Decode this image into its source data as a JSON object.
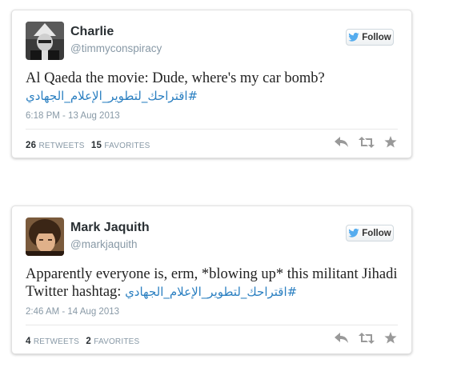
{
  "tweets": [
    {
      "author_name": "Charlie",
      "author_handle": "@timmyconspiracy",
      "follow_label": "Follow",
      "text": "Al Qaeda the movie: Dude, where's my car bomb?",
      "hashtag": "#اقتراحك_لتطوير_الإعلام_الجهادي",
      "timestamp": "6:18 PM - 13 Aug 2013",
      "retweets_count": "26",
      "retweets_label": "RETWEETS",
      "favorites_count": "15",
      "favorites_label": "FAVORITES"
    },
    {
      "author_name": "Mark Jaquith",
      "author_handle": "@markjaquith",
      "follow_label": "Follow",
      "text": "Apparently everyone is, erm, *blowing up* this militant Jihadi Twitter hashtag:",
      "hashtag": "#اقتراحك_لتطوير_الإعلام_الجهادي",
      "timestamp": "2:46 AM - 14 Aug 2013",
      "retweets_count": "4",
      "retweets_label": "RETWEETS",
      "favorites_count": "2",
      "favorites_label": "FAVORITES"
    }
  ],
  "icons": {
    "follow": "twitter-bird-icon",
    "reply": "reply-icon",
    "retweet": "retweet-icon",
    "favorite": "star-icon"
  },
  "colors": {
    "link": "#2a7fc1",
    "bird": "#55acee",
    "meta": "#8899a6",
    "action_icon": "#999999"
  }
}
